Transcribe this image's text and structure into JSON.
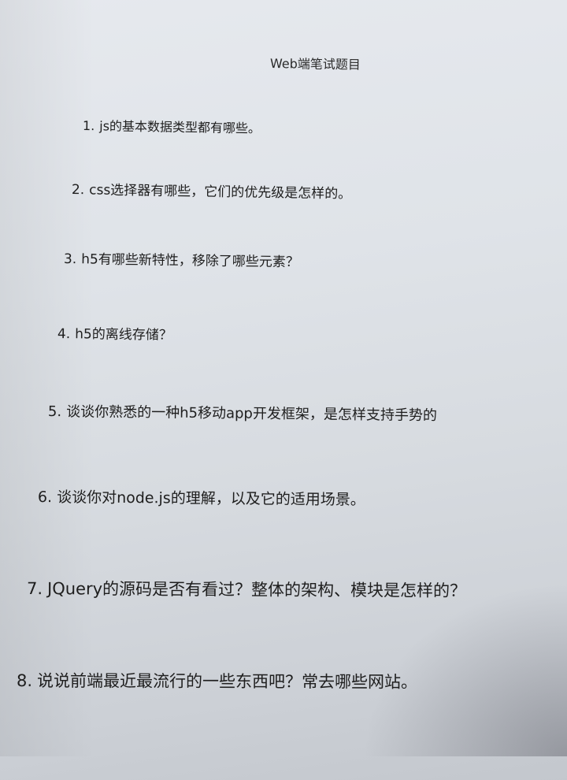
{
  "document": {
    "title": "Web端笔试题目",
    "questions": [
      {
        "number": "1.",
        "text": "js的基本数据类型都有哪些。"
      },
      {
        "number": "2.",
        "text": "css选择器有哪些，它们的优先级是怎样的。"
      },
      {
        "number": "3.",
        "text": "h5有哪些新特性，移除了哪些元素？"
      },
      {
        "number": "4.",
        "text": "h5的离线存储？"
      },
      {
        "number": "5.",
        "text": "谈谈你熟悉的一种h5移动app开发框架，是怎样支持手势的"
      },
      {
        "number": "6.",
        "text": "谈谈你对node.js的理解，以及它的适用场景。"
      },
      {
        "number": "7.",
        "text": "JQuery的源码是否有看过？整体的架构、模块是怎样的？"
      },
      {
        "number": "8.",
        "text": "说说前端最近最流行的一些东西吧？常去哪些网站。"
      }
    ]
  }
}
